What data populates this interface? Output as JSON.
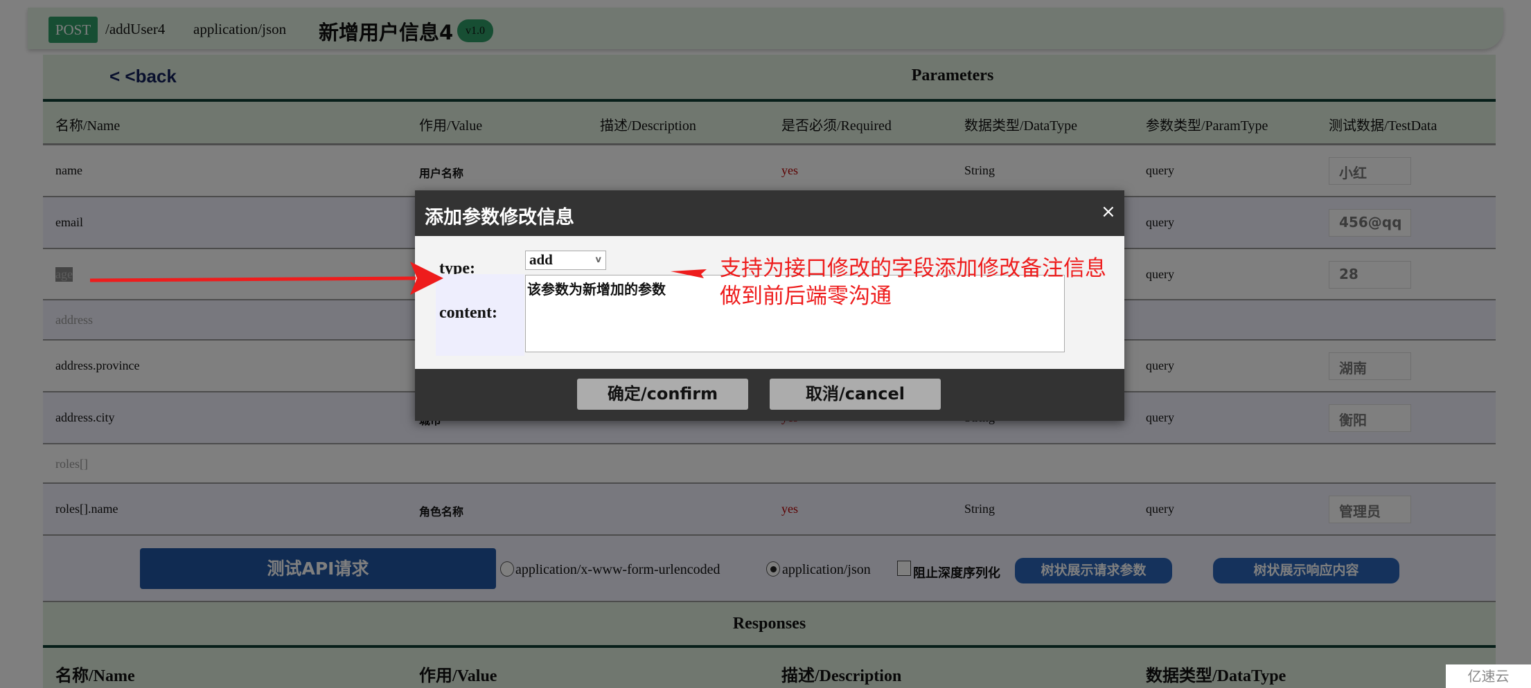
{
  "header": {
    "method": "POST",
    "path": "/addUser4",
    "content_type": "application/json",
    "title": "新增用户信息4",
    "version": "v1.0"
  },
  "params": {
    "back_label": "< <back",
    "title": "Parameters",
    "columns": [
      "名称/Name",
      "作用/Value",
      "描述/Description",
      "是否必须/Required",
      "数据类型/DataType",
      "参数类型/ParamType",
      "测试数据/TestData"
    ],
    "rows": [
      {
        "name": "name",
        "value": "用户名称",
        "required": "yes",
        "datatype": "String",
        "paramtype": "query",
        "test": "小红"
      },
      {
        "name": "email",
        "value": "",
        "required": "",
        "datatype": "",
        "paramtype": "query",
        "test": "456@qq"
      },
      {
        "name": "age",
        "value": "",
        "required": "",
        "datatype": "",
        "paramtype": "query",
        "test": "28"
      },
      {
        "name": "address"
      },
      {
        "name": "address.province",
        "value": "",
        "required": "",
        "datatype": "",
        "paramtype": "query",
        "test": "湖南"
      },
      {
        "name": "address.city",
        "value": "城市",
        "required": "yes",
        "datatype": "String",
        "paramtype": "query",
        "test": "衡阳"
      },
      {
        "name": "roles[]"
      },
      {
        "name": "roles[].name",
        "value": "角色名称",
        "required": "yes",
        "datatype": "String",
        "paramtype": "query",
        "test": "管理员"
      }
    ]
  },
  "actions": {
    "test_button": "测试API请求",
    "radio_form": "application/x-www-form-urlencoded",
    "radio_json": "application/json",
    "radio_selected": "application/json",
    "checkbox_label": "阻止深度序列化",
    "checkbox_checked": false,
    "tree_request": "树状展示请求参数",
    "tree_response": "树状展示响应内容"
  },
  "responses": {
    "title": "Responses",
    "columns": [
      "名称/Name",
      "作用/Value",
      "描述/Description",
      "数据类型/DataType"
    ]
  },
  "modal": {
    "title": "添加参数修改信息",
    "close": "×",
    "type_label": "type:",
    "type_value": "add",
    "content_label": "content:",
    "content_value": "该参数为新增加的参数",
    "confirm": "确定/confirm",
    "cancel": "取消/cancel"
  },
  "annotation": {
    "line1": "支持为接口修改的字段添加修改备注信息",
    "line2": "做到前后端零沟通",
    "color": "#ee1c1c"
  },
  "watermark": "亿速云"
}
